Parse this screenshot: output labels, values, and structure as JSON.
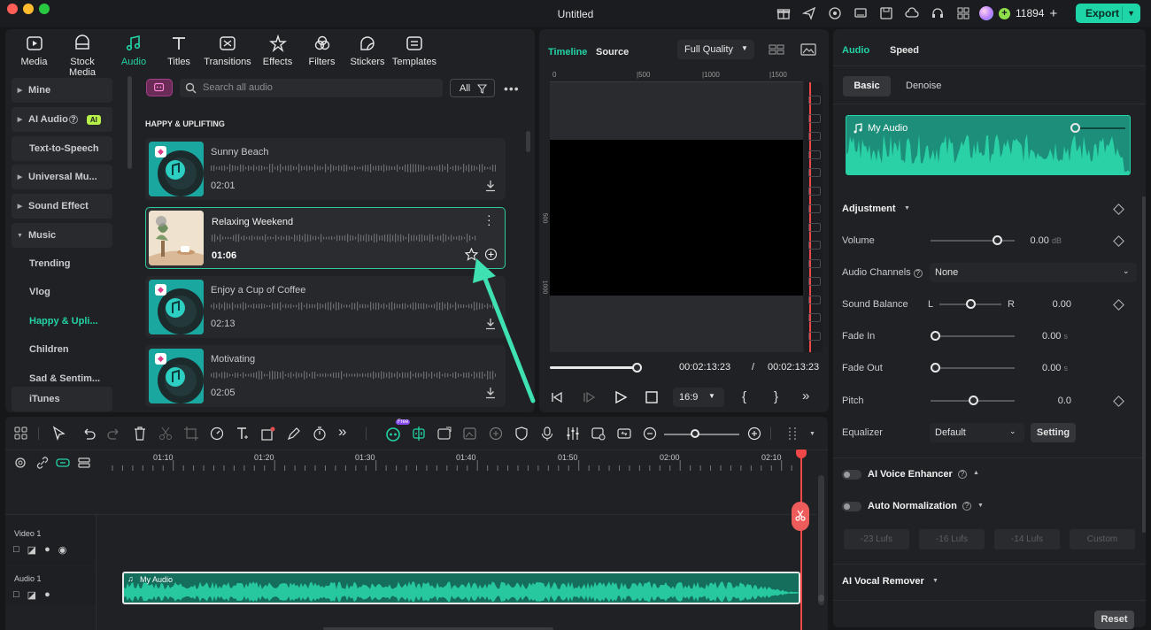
{
  "window": {
    "title": "Untitled",
    "credits": "11894",
    "export_label": "Export"
  },
  "media_tabs": [
    {
      "label": "Media",
      "icon": "media-icon"
    },
    {
      "label": "Stock Media",
      "icon": "stock-media-icon"
    },
    {
      "label": "Audio",
      "icon": "audio-icon",
      "active": true
    },
    {
      "label": "Titles",
      "icon": "titles-icon"
    },
    {
      "label": "Transitions",
      "icon": "transitions-icon"
    },
    {
      "label": "Effects",
      "icon": "effects-icon"
    },
    {
      "label": "Filters",
      "icon": "filters-icon"
    },
    {
      "label": "Stickers",
      "icon": "stickers-icon"
    },
    {
      "label": "Templates",
      "icon": "templates-icon"
    }
  ],
  "categories": {
    "mine": "Mine",
    "ai_audio": "AI Audio",
    "ai_badge": "AI",
    "tts": "Text-to-Speech",
    "universal": "Universal Mu...",
    "sound_effect": "Sound Effect",
    "music": "Music",
    "music_items": [
      "Trending",
      "Vlog",
      "Happy & Upli...",
      "Children",
      "Sad & Sentim..."
    ],
    "itunes": "iTunes"
  },
  "search": {
    "placeholder": "Search all audio",
    "filter_label": "All"
  },
  "section_title": "HAPPY & UPLIFTING",
  "tracks": [
    {
      "title": "Sunny Beach",
      "duration": "02:01"
    },
    {
      "title": "Relaxing Weekend",
      "duration": "01:06"
    },
    {
      "title": "Enjoy a Cup of Coffee",
      "duration": "02:13"
    },
    {
      "title": "Motivating",
      "duration": "02:05"
    }
  ],
  "preview": {
    "tab_timeline": "Timeline",
    "tab_source": "Source",
    "quality": "Full Quality",
    "ruler": [
      "0",
      "|500",
      "|1000",
      "|1500"
    ],
    "vruler": [
      "500",
      "1000"
    ],
    "current_time": "00:02:13:23",
    "separator": "/",
    "total_time": "00:02:13:23",
    "aspect": "16:9",
    "progress": 1.0
  },
  "inspector": {
    "tab_audio": "Audio",
    "tab_speed": "Speed",
    "sub_basic": "Basic",
    "sub_denoise": "Denoise",
    "clip_name": "My Audio",
    "adjustment": "Adjustment",
    "volume_label": "Volume",
    "volume_value": "0.00",
    "volume_unit": "dB",
    "volume_level": 0.5,
    "channels_label": "Audio Channels",
    "channels_value": "None",
    "balance_label": "Sound Balance",
    "balance_l": "L",
    "balance_r": "R",
    "balance_value": "0.00",
    "balance_level": 0.5,
    "fadein_label": "Fade In",
    "fadein_value": "0.00",
    "fadein_unit": "s",
    "fadein_level": 0.0,
    "fadeout_label": "Fade Out",
    "fadeout_value": "0.00",
    "fadeout_unit": "s",
    "fadeout_level": 0.0,
    "pitch_label": "Pitch",
    "pitch_value": "0.0",
    "pitch_level": 0.5,
    "equalizer_label": "Equalizer",
    "equalizer_value": "Default",
    "setting_label": "Setting",
    "voice_enhancer": "AI Voice Enhancer",
    "auto_norm": "Auto Normalization",
    "lufs": [
      "-23 Lufs",
      "-16 Lufs",
      "-14 Lufs",
      "Custom"
    ],
    "vocal_remover": "AI Vocal Remover",
    "reset_label": "Reset"
  },
  "timeline": {
    "free_badge": "Free",
    "ruler": [
      "01:10",
      "01:20",
      "01:30",
      "01:40",
      "01:50",
      "02:00",
      "02:10"
    ],
    "video_track": "Video 1",
    "audio_track": "Audio 1",
    "audio_clip": "My Audio"
  },
  "colors": {
    "accent": "#1ed5a8",
    "playhead": "#f04848",
    "waveform": "#1f9f86"
  }
}
